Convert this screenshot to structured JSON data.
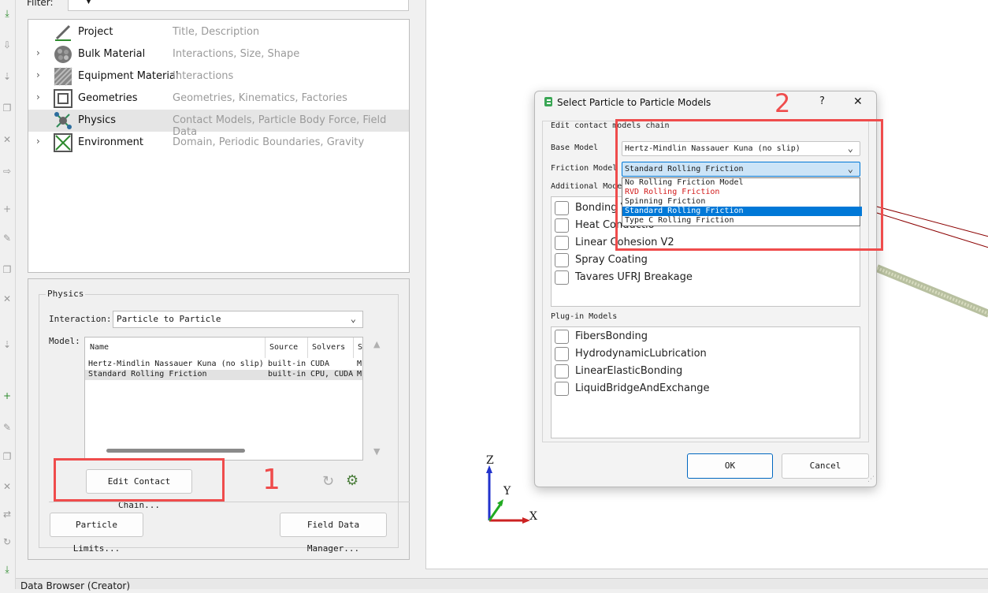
{
  "filter": {
    "label": "Filter:"
  },
  "tree": [
    {
      "name": "Project",
      "desc": "Title, Description",
      "icon": "pencil-icon",
      "expandable": false
    },
    {
      "name": "Bulk Material",
      "desc": "Interactions, Size, Shape",
      "icon": "bulk-material-icon",
      "expandable": true
    },
    {
      "name": "Equipment Material",
      "desc": "Interactions",
      "icon": "equipment-material-icon",
      "expandable": true
    },
    {
      "name": "Geometries",
      "desc": "Geometries, Kinematics, Factories",
      "icon": "geometry-icon",
      "expandable": true
    },
    {
      "name": "Physics",
      "desc": "Contact Models, Particle Body Force, Field Data",
      "icon": "physics-icon",
      "expandable": false,
      "selected": true
    },
    {
      "name": "Environment",
      "desc": "Domain, Periodic Boundaries, Gravity",
      "icon": "environment-icon",
      "expandable": true
    }
  ],
  "physics": {
    "group_title": "Physics",
    "interaction_label": "Interaction:",
    "interaction_value": "Particle to Particle",
    "model_label": "Model:",
    "columns": [
      "Name",
      "Source",
      "Solvers",
      "S"
    ],
    "rows": [
      {
        "name": "Hertz-Mindlin Nassauer Kuna (no slip)",
        "source": "built-in",
        "solvers": "CUDA",
        "extra": "M"
      },
      {
        "name": "Standard Rolling Friction",
        "source": "built-in",
        "solvers": "CPU, CUDA",
        "extra": "M"
      }
    ],
    "edit_chain_button": "Edit Contact Chain...",
    "particle_limits_button": "Particle Limits...",
    "field_data_button": "Field Data Manager..."
  },
  "annotations": {
    "num1": "1",
    "num2": "2",
    "color": "#ef4c4c"
  },
  "status_bar": "Data Browser (Creator)",
  "axes": {
    "z": "Z",
    "y": "Y",
    "x": "X"
  },
  "dialog": {
    "title": "Select Particle to Particle Models",
    "help": "?",
    "close": "✕",
    "section_label": "Edit contact models chain",
    "base_model_label": "Base Model",
    "base_model_value": "Hertz-Mindlin Nassauer Kuna (no slip)",
    "friction_model_label": "Friction Model",
    "friction_model_value": "Standard Rolling Friction",
    "friction_options": [
      {
        "label": "No Rolling Friction Model",
        "style": "normal"
      },
      {
        "label": "RVD Rolling Friction",
        "style": "red"
      },
      {
        "label": "Spinning Friction",
        "style": "normal"
      },
      {
        "label": "Standard Rolling Friction",
        "style": "highlighted"
      },
      {
        "label": "Type C Rolling Friction",
        "style": "normal"
      }
    ],
    "additional_label": "Additional Mode",
    "additional_models": [
      "Bonding V",
      "Heat Conductio",
      "Linear Cohesion V2",
      "Spray Coating",
      "Tavares UFRJ Breakage"
    ],
    "plugin_label": "Plug-in Models",
    "plugin_models": [
      "FibersBonding",
      "HydrodynamicLubrication",
      "LinearElasticBonding",
      "LiquidBridgeAndExchange"
    ],
    "ok": "OK",
    "cancel": "Cancel"
  }
}
